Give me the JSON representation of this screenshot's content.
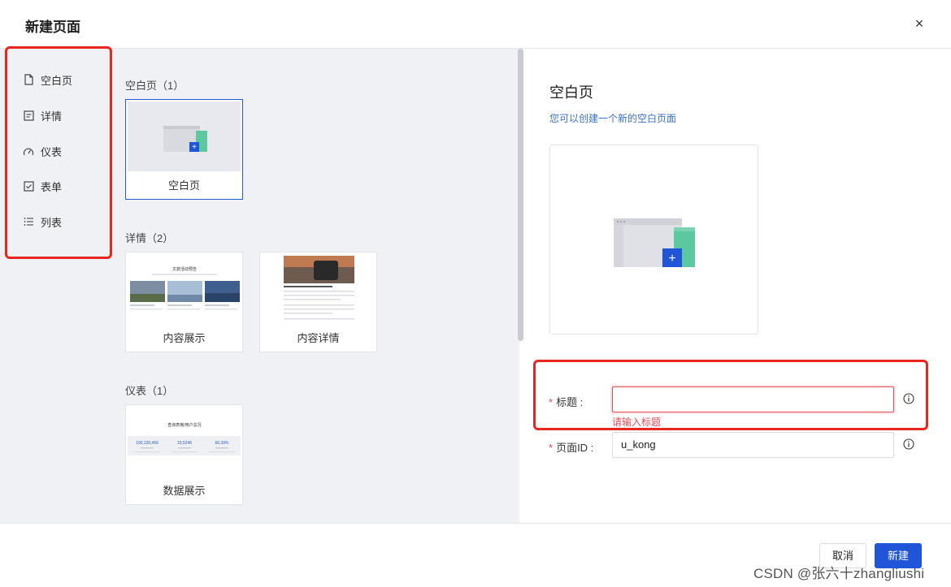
{
  "dialog": {
    "title": "新建页面",
    "close": "×"
  },
  "nav": {
    "items": [
      {
        "label": "空白页",
        "icon": "file-icon"
      },
      {
        "label": "详情",
        "icon": "detail-icon"
      },
      {
        "label": "仪表",
        "icon": "gauge-icon"
      },
      {
        "label": "表单",
        "icon": "checkbox-icon"
      },
      {
        "label": "列表",
        "icon": "list-icon"
      }
    ]
  },
  "sections": [
    {
      "label": "空白页（1）",
      "cards": [
        {
          "caption": "空白页",
          "selected": true
        }
      ]
    },
    {
      "label": "详情（2）",
      "cards": [
        {
          "caption": "内容展示",
          "thumb_title": "文旅活动预告"
        },
        {
          "caption": "内容详情"
        }
      ]
    },
    {
      "label": "仪表（1）",
      "cards": [
        {
          "caption": "数据展示",
          "thumb_title": "查询表格/用户总况",
          "stats": [
            "100,120,456",
            "15,5246",
            "66.39%"
          ]
        }
      ]
    }
  ],
  "detail": {
    "title": "空白页",
    "description": "您可以创建一个新的空白页面"
  },
  "form": {
    "title_label": "标题 :",
    "title_value": "",
    "title_error": "请输入标题",
    "page_id_label": "页面ID :",
    "page_id_value": "u_kong",
    "required_mark": "*"
  },
  "footer": {
    "cancel": "取消",
    "create": "新建"
  },
  "watermark": "CSDN @张六十zhangliushi",
  "colors": {
    "primary": "#1f55d6",
    "error": "#e34d59",
    "highlight": "#e8261f",
    "panel_bg": "#f0f1f5",
    "green": "#5cc8a0"
  }
}
